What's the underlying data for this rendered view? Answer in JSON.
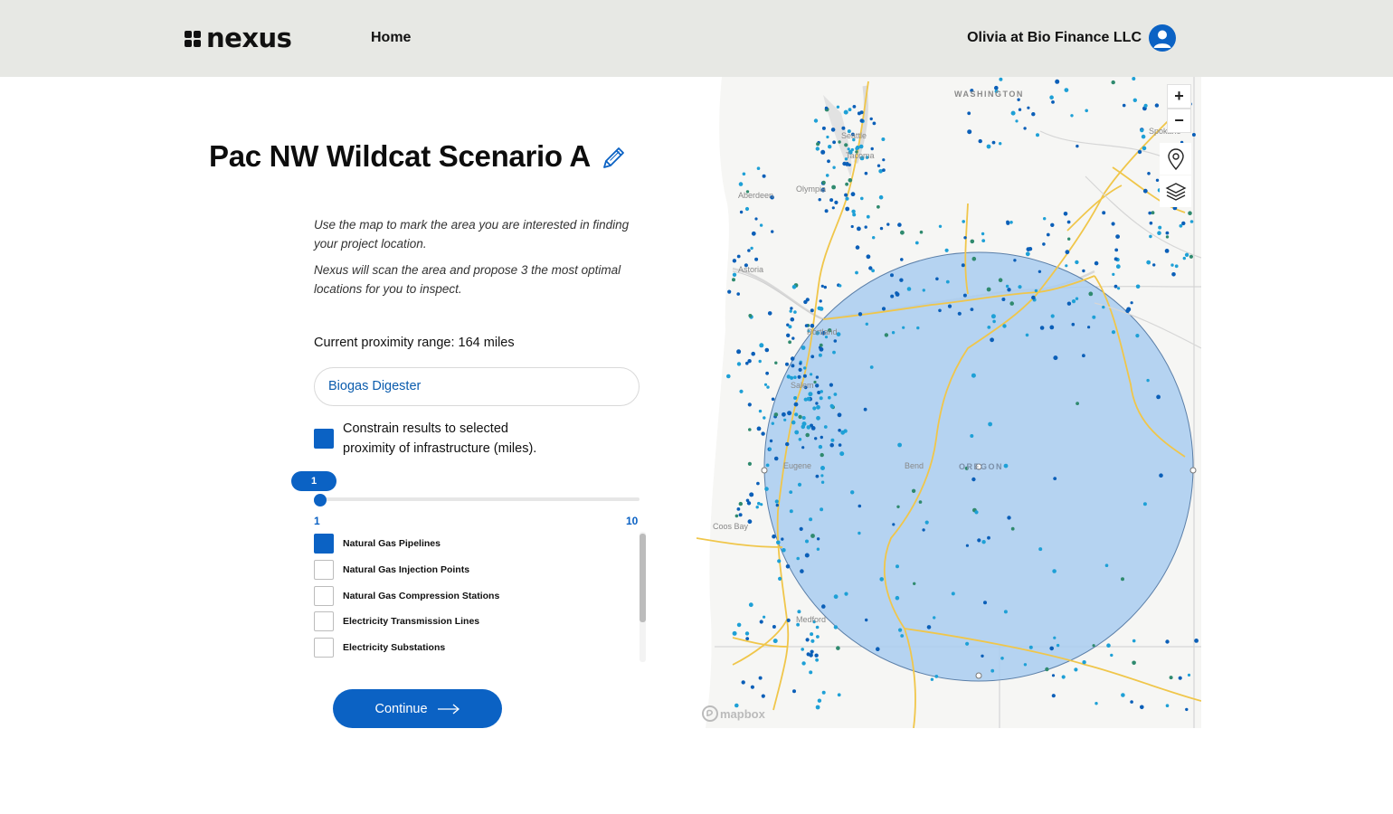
{
  "header": {
    "brand": "nexus",
    "nav_home": "Home",
    "user_label": "Olivia at Bio Finance LLC"
  },
  "scenario": {
    "title": "Pac NW Wildcat Scenario A",
    "instructions_1": "Use the map to mark the area you are interested in finding your project location.",
    "instructions_2": "Nexus will scan the area and propose 3 the most optimal locations for you to inspect.",
    "proximity_label": "Current proximity range: 164 miles",
    "facility_type": "Biogas Digester",
    "constrain_label": "Constrain results to selected proximity of infrastructure (miles).",
    "constrain_checked": true
  },
  "slider": {
    "current_value": "1",
    "min_label": "1",
    "max_label": "10",
    "value": 1,
    "min": 1,
    "max": 10
  },
  "infrastructure": [
    {
      "label": "Natural Gas Pipelines",
      "checked": true
    },
    {
      "label": "Natural Gas Injection Points",
      "checked": false
    },
    {
      "label": "Natural Gas Compression Stations",
      "checked": false
    },
    {
      "label": "Electricity Transmission Lines",
      "checked": false
    },
    {
      "label": "Electricity Substations",
      "checked": false
    }
  ],
  "actions": {
    "continue_label": "Continue"
  },
  "map": {
    "zoom_in": "+",
    "zoom_out": "−",
    "state_labels": [
      "WASHINGTON",
      "OREGON"
    ],
    "city_labels": [
      "Seattle",
      "Tacoma",
      "Olympia",
      "Aberdeen",
      "Astoria",
      "Portland",
      "Salem",
      "Eugene",
      "Bend",
      "Coos Bay",
      "Medford",
      "Spokane"
    ],
    "attribution": "mapbox",
    "colors": {
      "selection_fill": "#a9cdf0",
      "pipeline": "#f0c64a",
      "point_dark": "#0b5fb8",
      "point_light": "#1ea0d6",
      "point_green": "#2f8a6e"
    }
  },
  "colors": {
    "accent": "#0b62c4",
    "header_bg": "#e7e8e4"
  }
}
